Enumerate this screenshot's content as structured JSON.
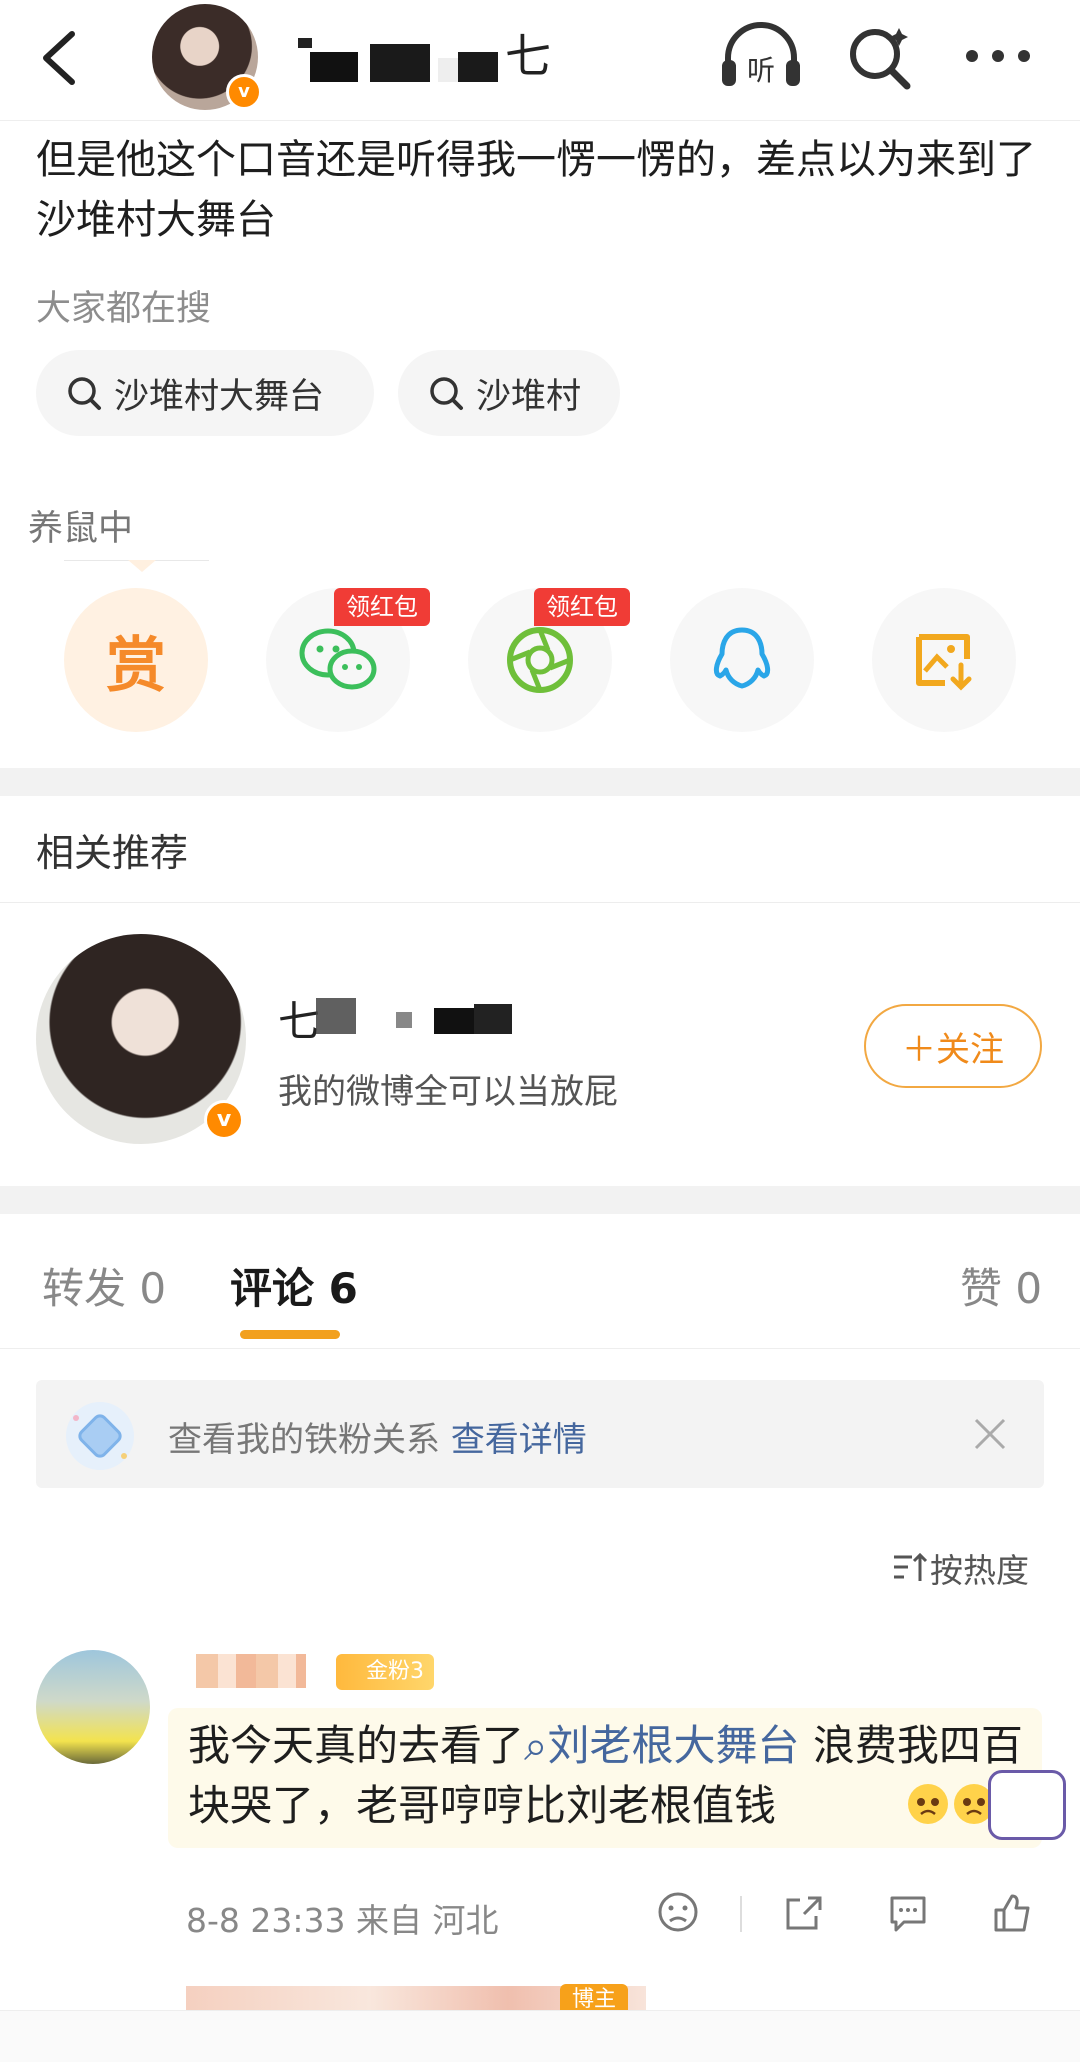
{
  "header": {
    "title": "七",
    "icons": [
      "back-icon",
      "listen-icon",
      "search-icon",
      "more-icon"
    ],
    "listen_label": "听"
  },
  "post": {
    "text": "但是他这个口音还是听得我一愣一愣的，差点以为来到了沙堆村大舞台"
  },
  "hot_search": {
    "title": "大家都在搜",
    "chips": [
      "沙堆村大舞台",
      "沙堆村"
    ]
  },
  "share": {
    "label": "养鼠中",
    "reward_label": "赏",
    "red_tag": "领红包",
    "icons": [
      "reward-icon",
      "wechat-icon",
      "moments-icon",
      "qq-icon",
      "save-image-icon"
    ]
  },
  "recommend": {
    "title": "相关推荐",
    "name": "七",
    "desc": "我的微博全可以当放屁",
    "follow": "＋关注",
    "verified": "v"
  },
  "tabs": {
    "repost": "转发 0",
    "comment": "评论 6",
    "like": "赞 0"
  },
  "fan_bar": {
    "text": "查看我的铁粉关系",
    "link": "查看详情"
  },
  "sort": {
    "label": "按热度"
  },
  "comment": {
    "badge": "金粉3",
    "text_before": "我今天真的去看了",
    "link": "刘老根大舞台",
    "text_after": " 浪费我四百块哭了，老哥哼哼比刘老根值钱",
    "meta": "8-8 23:33  来自 河北"
  },
  "next_comment": {
    "badge": "博主"
  },
  "colors": {
    "accent": "#f2a01e",
    "link": "#45679e",
    "red_tag": "#f03c36"
  }
}
